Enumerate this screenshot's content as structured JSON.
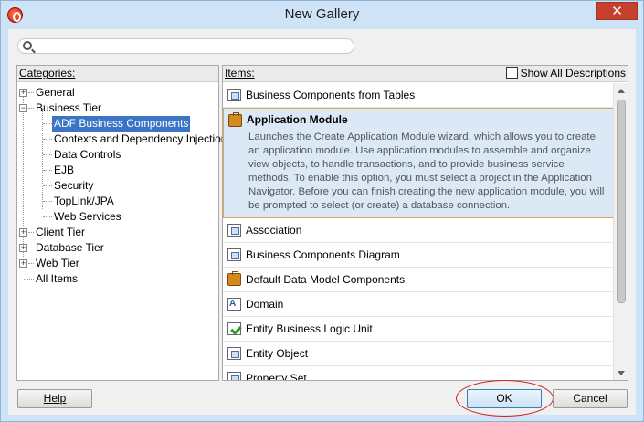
{
  "window": {
    "title": "New Gallery",
    "close_glyph": "✕"
  },
  "search": {
    "placeholder": "",
    "value": ""
  },
  "categories": {
    "header": "Categories:",
    "tree": [
      {
        "label": "General",
        "toggle": "+"
      },
      {
        "label": "Business Tier",
        "toggle": "−"
      },
      {
        "label": "ADF Business Components",
        "selected": true
      },
      {
        "label": "Contexts and Dependency Injection"
      },
      {
        "label": "Data Controls"
      },
      {
        "label": "EJB"
      },
      {
        "label": "Security"
      },
      {
        "label": "TopLink/JPA"
      },
      {
        "label": "Web Services"
      },
      {
        "label": "Client Tier",
        "toggle": "+"
      },
      {
        "label": "Database Tier",
        "toggle": "+"
      },
      {
        "label": "Web Tier",
        "toggle": "+"
      },
      {
        "label": "All Items"
      }
    ]
  },
  "items": {
    "header": "Items:",
    "show_all_label": "Show All Descriptions",
    "show_all_checked": false,
    "list": [
      {
        "label": "Business Components from Tables",
        "icon": "business-components-icon"
      },
      {
        "label": "Application Module",
        "icon": "briefcase-icon",
        "selected": true,
        "description": "Launches the Create Application Module wizard, which allows you to create an application module. Use application modules to assemble and organize view objects, to handle transactions, and to provide business service methods. To enable this option, you must select a project in the Application Navigator. Before you can finish creating the new application module, you will be prompted to select (or create) a database connection."
      },
      {
        "label": "Association",
        "icon": "association-icon"
      },
      {
        "label": "Business Components Diagram",
        "icon": "diagram-icon"
      },
      {
        "label": "Default Data Model Components",
        "icon": "data-model-icon"
      },
      {
        "label": "Domain",
        "icon": "domain-icon"
      },
      {
        "label": "Entity Business Logic Unit",
        "icon": "logic-unit-icon"
      },
      {
        "label": "Entity Object",
        "icon": "entity-object-icon"
      },
      {
        "label": "Property Set",
        "icon": "property-set-icon"
      }
    ]
  },
  "buttons": {
    "help": "Help",
    "ok": "OK",
    "cancel": "Cancel"
  }
}
